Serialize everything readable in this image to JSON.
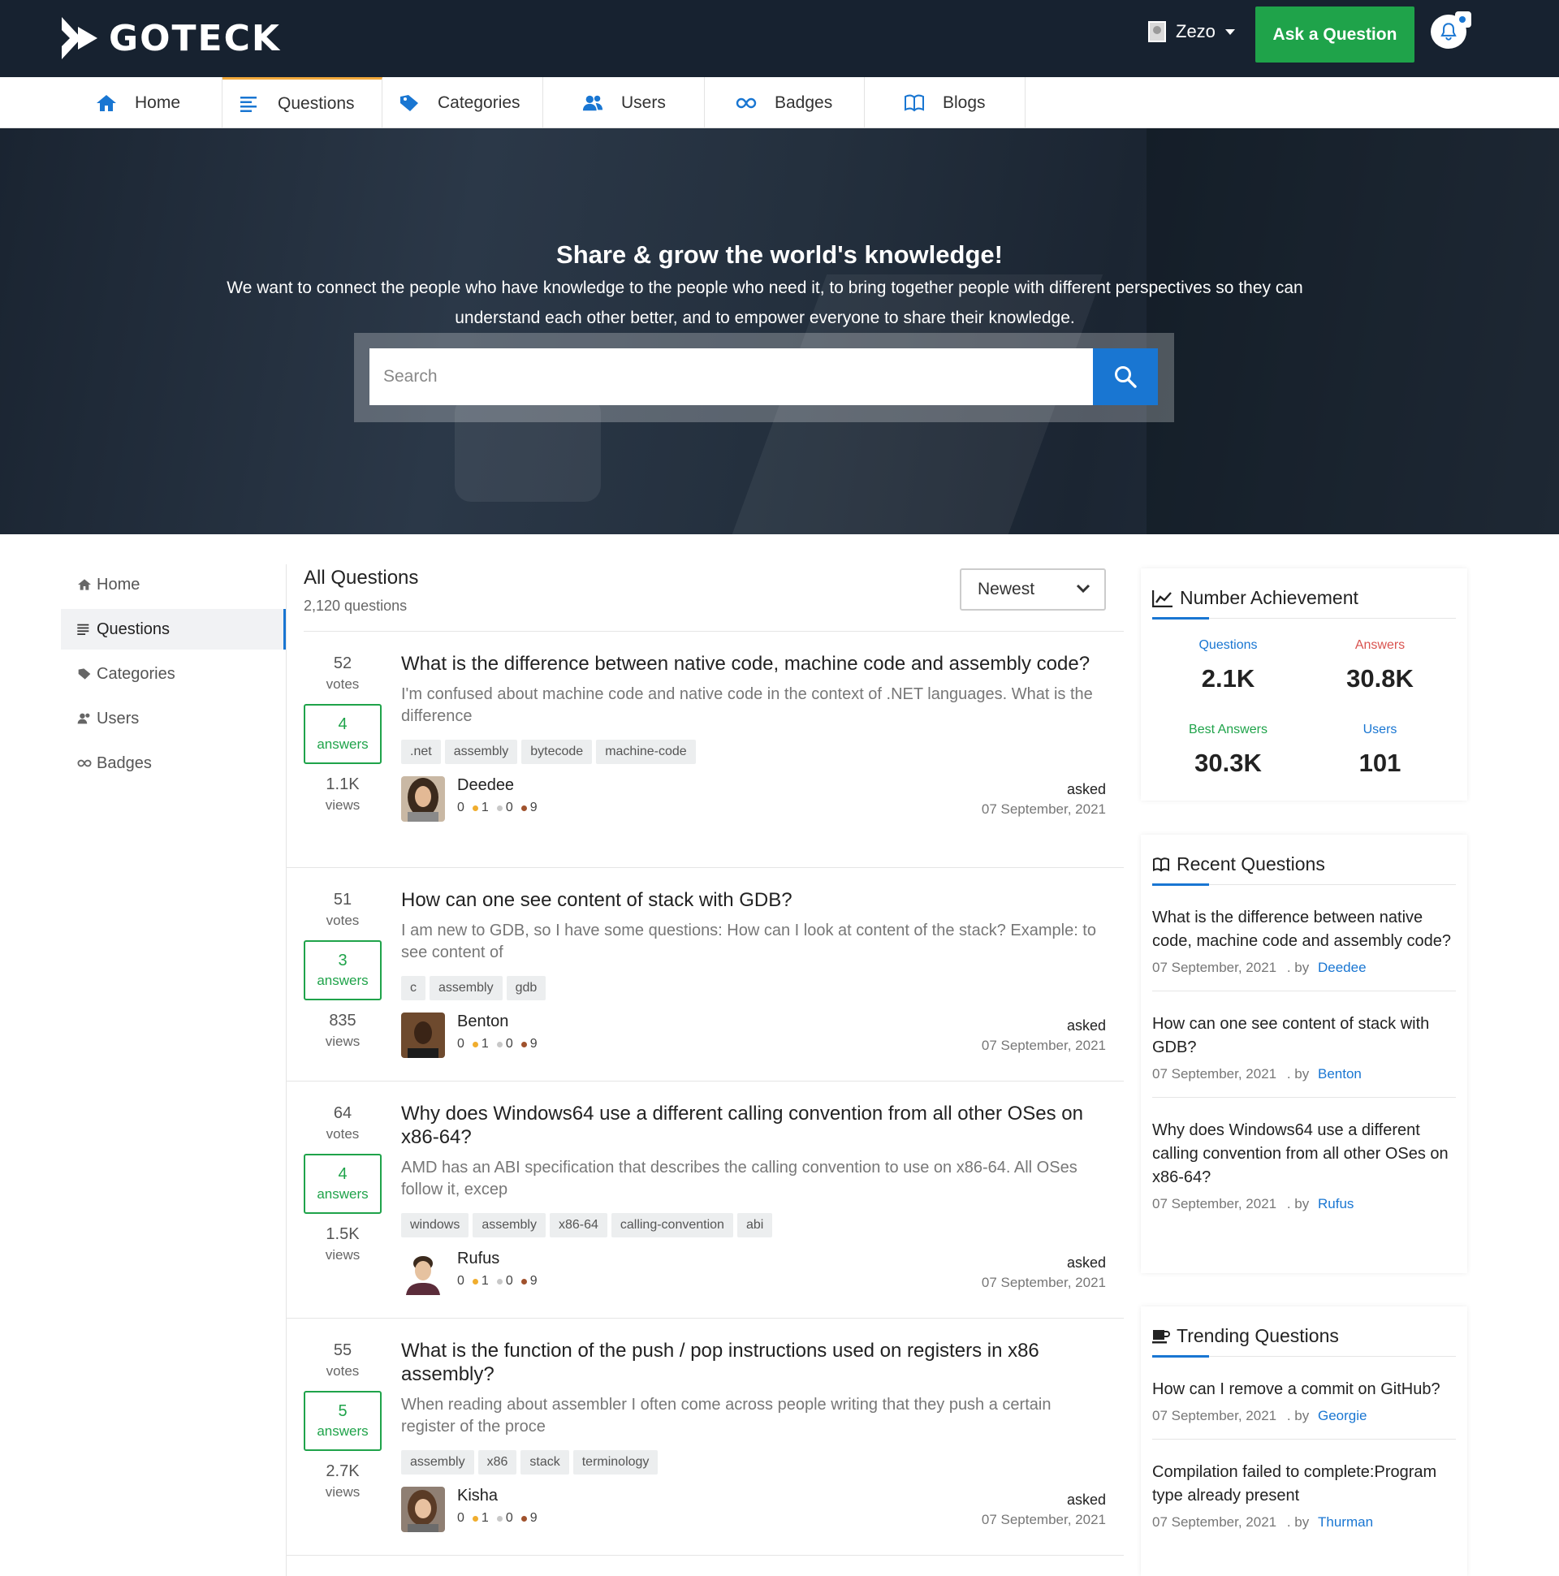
{
  "colors": {
    "topbar": "#172230",
    "accent_green": "#1fa34a",
    "accent_blue": "#1976d2",
    "active_tab_border": "#f1a93b"
  },
  "header": {
    "logo_text": "GOTECK",
    "user_name": "Zezo",
    "ask_button": "Ask a Question",
    "notification_icon": "bell-icon"
  },
  "nav": {
    "items": [
      {
        "label": "Home",
        "icon": "home-icon"
      },
      {
        "label": "Questions",
        "icon": "list-icon"
      },
      {
        "label": "Categories",
        "icon": "tag-icon"
      },
      {
        "label": "Users",
        "icon": "users-icon"
      },
      {
        "label": "Badges",
        "icon": "infinity-icon"
      },
      {
        "label": "Blogs",
        "icon": "book-icon"
      }
    ],
    "active": "Questions"
  },
  "hero": {
    "title": "Share & grow the world's knowledge!",
    "subtitle": "We want to connect the people who have knowledge to the people who need it, to bring together people with different perspectives so they can understand each other better, and to empower everyone to share their knowledge.",
    "search_placeholder": "Search"
  },
  "sidebar": {
    "items": [
      {
        "label": "Home",
        "icon": "home-icon"
      },
      {
        "label": "Questions",
        "icon": "list-icon"
      },
      {
        "label": "Categories",
        "icon": "tag-icon"
      },
      {
        "label": "Users",
        "icon": "users-icon"
      },
      {
        "label": "Badges",
        "icon": "infinity-icon"
      }
    ]
  },
  "questions": {
    "title": "All Questions",
    "count": "2,120 questions",
    "sort": "Newest",
    "items": [
      {
        "votes": "52",
        "votes_label": "votes",
        "answers": "4",
        "answers_label": "answers",
        "views": "1.1K",
        "views_label": "views",
        "title": "What is the difference between native code, machine code and assembly code?",
        "excerpt": "I'm confused about machine code and native code in the context of .NET languages. What is the difference",
        "tags": [
          ".net",
          "assembly",
          "bytecode",
          "machine-code"
        ],
        "author": "Deedee",
        "rep": "0",
        "gold": "1",
        "silver": "0",
        "bronze": "9",
        "asked_label": "asked",
        "date": "07 September, 2021"
      },
      {
        "votes": "51",
        "votes_label": "votes",
        "answers": "3",
        "answers_label": "answers",
        "views": "835",
        "views_label": "views",
        "title": "How can one see content of stack with GDB?",
        "excerpt": "I am new to GDB, so I have some questions: How can I look at content of the stack? Example: to see content of",
        "tags": [
          "c",
          "assembly",
          "gdb"
        ],
        "author": "Benton",
        "rep": "0",
        "gold": "1",
        "silver": "0",
        "bronze": "9",
        "asked_label": "asked",
        "date": "07 September, 2021"
      },
      {
        "votes": "64",
        "votes_label": "votes",
        "answers": "4",
        "answers_label": "answers",
        "views": "1.5K",
        "views_label": "views",
        "title": "Why does Windows64 use a different calling convention from all other OSes on x86-64?",
        "excerpt": "AMD has an ABI specification that describes the calling convention to use on x86-64. All OSes follow it, excep",
        "tags": [
          "windows",
          "assembly",
          "x86-64",
          "calling-convention",
          "abi"
        ],
        "author": "Rufus",
        "rep": "0",
        "gold": "1",
        "silver": "0",
        "bronze": "9",
        "asked_label": "asked",
        "date": "07 September, 2021"
      },
      {
        "votes": "55",
        "votes_label": "votes",
        "answers": "5",
        "answers_label": "answers",
        "views": "2.7K",
        "views_label": "views",
        "title": "What is the function of the push / pop instructions used on registers in x86 assembly?",
        "excerpt": "When reading about assembler I often come across people writing that they push a certain register of the proce",
        "tags": [
          "assembly",
          "x86",
          "stack",
          "terminology"
        ],
        "author": "Kisha",
        "rep": "0",
        "gold": "1",
        "silver": "0",
        "bronze": "9",
        "asked_label": "asked",
        "date": "07 September, 2021"
      }
    ]
  },
  "achievement": {
    "title": "Number Achievement",
    "stats": [
      {
        "label": "Questions",
        "value": "2.1K",
        "color": "#1976d2"
      },
      {
        "label": "Answers",
        "value": "30.8K",
        "color": "#d9534f"
      },
      {
        "label": "Best Answers",
        "value": "30.3K",
        "color": "#1fa34a"
      },
      {
        "label": "Users",
        "value": "101",
        "color": "#1976d2"
      }
    ]
  },
  "recent": {
    "title": "Recent Questions",
    "items": [
      {
        "title": "What is the difference between native code, machine code and assembly code?",
        "date": "07 September, 2021",
        "by_label": ". by",
        "author": "Deedee"
      },
      {
        "title": "How can one see content of stack with GDB?",
        "date": "07 September, 2021",
        "by_label": ". by",
        "author": "Benton"
      },
      {
        "title": "Why does Windows64 use a different calling convention from all other OSes on x86-64?",
        "date": "07 September, 2021",
        "by_label": ". by",
        "author": "Rufus"
      }
    ]
  },
  "trending": {
    "title": "Trending Questions",
    "items": [
      {
        "title": "How can I remove a commit on GitHub?",
        "date": "07 September, 2021",
        "by_label": ". by",
        "author": "Georgie"
      },
      {
        "title": "Compilation failed to complete:Program type already present",
        "date": "07 September, 2021",
        "by_label": ". by",
        "author": "Thurman"
      }
    ]
  }
}
